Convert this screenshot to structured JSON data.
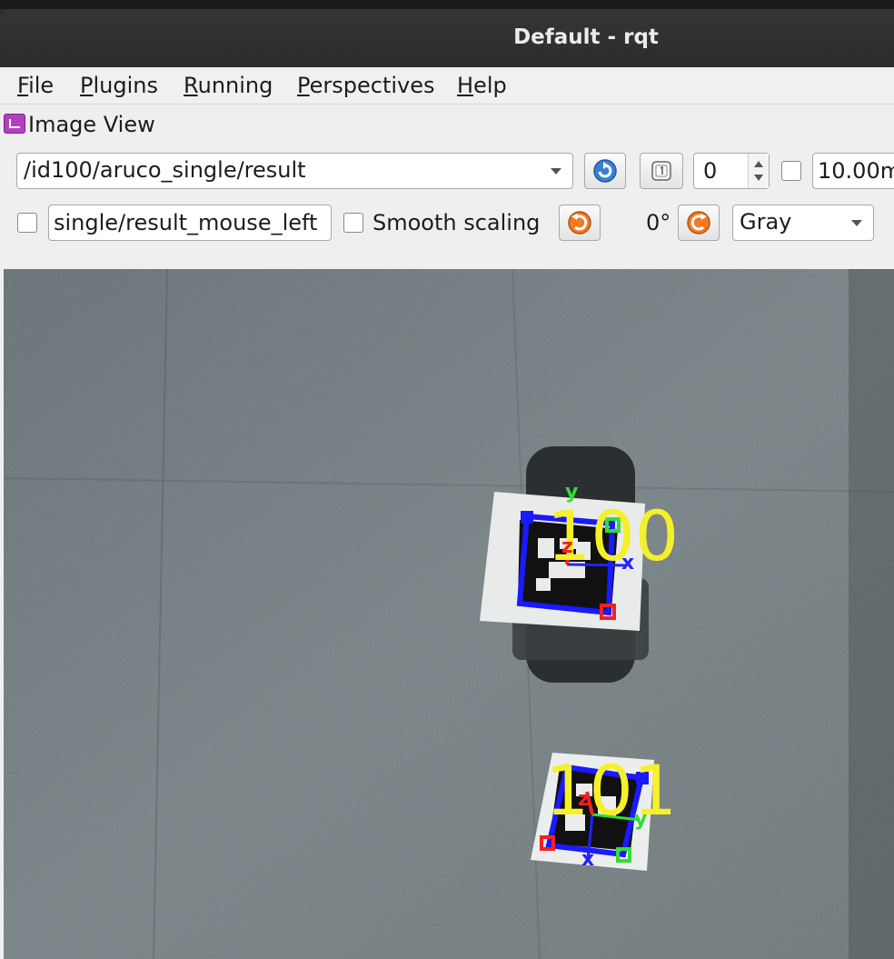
{
  "window": {
    "title": "Default - rqt"
  },
  "menubar": {
    "items": [
      {
        "mnemonic": "F",
        "rest": "ile"
      },
      {
        "mnemonic": "P",
        "rest": "lugins"
      },
      {
        "mnemonic": "R",
        "rest": "unning"
      },
      {
        "mnemonic": "P",
        "pre": "",
        "rest": "erspectives",
        "full": "Perspectives",
        "mnemonic_index": 1
      },
      {
        "mnemonic": "H",
        "rest": "elp"
      }
    ]
  },
  "dock": {
    "title": "Image View"
  },
  "toolbar": {
    "topic": "/id100/aruco_single/result",
    "refresh_icon": "refresh-icon",
    "zoom_icon": "zoom-1-icon",
    "zoom_value": "0",
    "rate_value": "10.00m",
    "mouse_topic": "single/result_mouse_left",
    "smooth_scaling_label": "Smooth scaling",
    "rotate_left_icon": "rotate-ccw-icon",
    "rotation_label": "0°",
    "rotate_right_icon": "rotate-cw-icon",
    "color_scheme": "Gray"
  },
  "image": {
    "markers": [
      {
        "id_label": "100",
        "axis_x": "x",
        "axis_y": "y",
        "axis_z": "z"
      },
      {
        "id_label": "101",
        "axis_x": "x",
        "axis_y": "y",
        "axis_z": "z"
      }
    ],
    "colors": {
      "marker_outline": "#1a1aff",
      "id_text": "#f5f02a",
      "axis_x": "#2222ff",
      "axis_y": "#33dd33",
      "axis_z": "#ee2222"
    }
  }
}
